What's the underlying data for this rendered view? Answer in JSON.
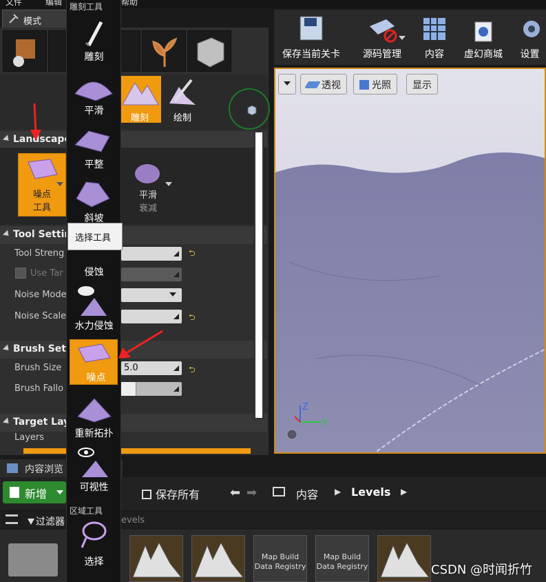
{
  "menu": {
    "file": "文件",
    "edit": "编辑",
    "help": "帮助"
  },
  "mode_tab": {
    "label": "模式"
  },
  "landscape_tools": {
    "sculpt": "雕刻",
    "paint": "绘制"
  },
  "sections": {
    "landscape": "Landscape",
    "tool_settings": "Tool Settin",
    "brush_settings": "Brush Sett",
    "target_layers": "Target Lay"
  },
  "brushes": {
    "noise_line1": "噪点",
    "noise_line2": "工具",
    "smooth_line1": "平滑",
    "smooth_line2": "衰减"
  },
  "tool_settings": {
    "tool_strength": "Tool Streng",
    "use_target": "Use Tar",
    "noise_mode": "Noise Mode",
    "noise_scale": "Noise Scale"
  },
  "brush_settings": {
    "brush_size": "Brush Size",
    "brush_size_value": "5.0",
    "brush_falloff": "Brush Fallo"
  },
  "layers_label": "Layers",
  "dropdown": {
    "header": "雕刻工具",
    "items": [
      "雕刻",
      "平滑",
      "平整",
      "斜坡",
      "侵蚀",
      "水力侵蚀",
      "噪点",
      "重新拓扑",
      "可视性"
    ],
    "region_header": "区域工具",
    "region_items": [
      "选择"
    ],
    "tooltip": "选择工具"
  },
  "toolbar": {
    "save_level": "保存当前关卡",
    "source_control": "源码管理",
    "content": "内容",
    "marketplace": "虚幻商城",
    "settings": "设置"
  },
  "viewport": {
    "perspective": "透视",
    "lit": "光照",
    "show": "显示",
    "axis_z": "Z",
    "axis_y": "Y"
  },
  "content_browser": {
    "tab": "内容浏览",
    "new": "新增",
    "save_all": "保存所有",
    "path_content": "内容",
    "path_levels": "Levels",
    "filters": "过滤器",
    "search_hint": "evels",
    "asset_map_build_1": "Map Build",
    "asset_map_build_2": "Data Registry"
  },
  "watermark": "CSDN @时闻折竹",
  "colors": {
    "accent": "#f09a10",
    "viewport_bg": "#9a9ab8",
    "new_green": "#2e8a2e"
  }
}
